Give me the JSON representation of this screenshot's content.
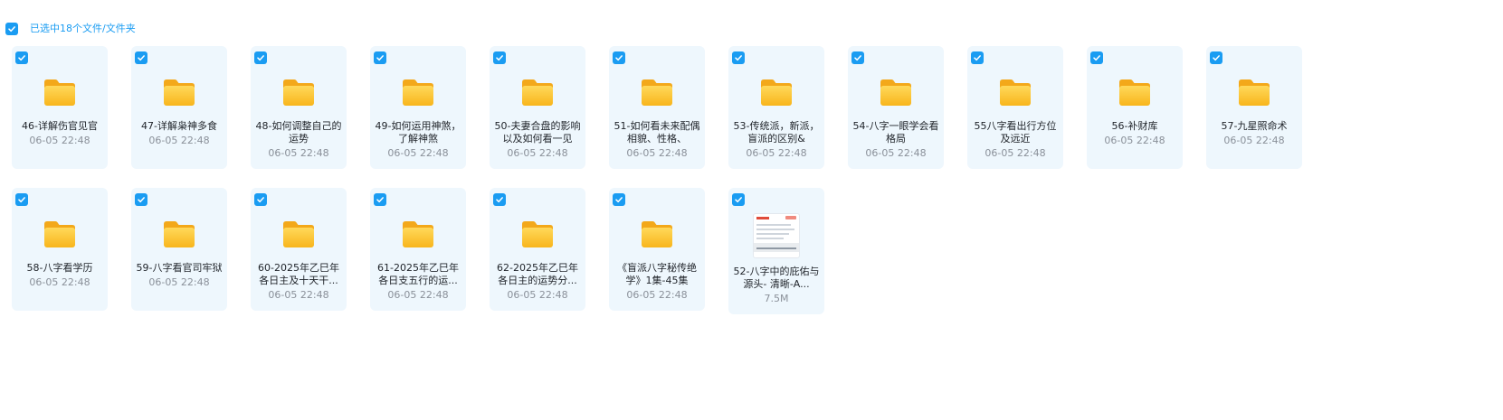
{
  "selection": {
    "label": "已选中18个文件/文件夹"
  },
  "items": [
    {
      "name": "46-详解伤官见官",
      "meta": "06-05 22:48",
      "type": "folder"
    },
    {
      "name": "47-详解枭神多食",
      "meta": "06-05 22:48",
      "type": "folder"
    },
    {
      "name": "48-如何调整自己的运势",
      "meta": "06-05 22:48",
      "type": "folder"
    },
    {
      "name": "49-如何运用神煞，了解神煞",
      "meta": "06-05 22:48",
      "type": "folder"
    },
    {
      "name": "50-夫妻合盘的影响以及如何看一见",
      "meta": "06-05 22:48",
      "type": "folder"
    },
    {
      "name": "51-如何看未来配偶 相貌、性格、",
      "meta": "06-05 22:48",
      "type": "folder"
    },
    {
      "name": "53-传统派，新派，盲派的区别&",
      "meta": "06-05 22:48",
      "type": "folder"
    },
    {
      "name": "54-八字一眼学会看格局",
      "meta": "06-05 22:48",
      "type": "folder"
    },
    {
      "name": "55八字看出行方位及远近",
      "meta": "06-05 22:48",
      "type": "folder"
    },
    {
      "name": "56-补财库",
      "meta": "06-05 22:48",
      "type": "folder"
    },
    {
      "name": "57-九星照命术",
      "meta": "06-05 22:48",
      "type": "folder"
    },
    {
      "name": "58-八字看学历",
      "meta": "06-05 22:48",
      "type": "folder"
    },
    {
      "name": "59-八字看官司牢狱",
      "meta": "06-05 22:48",
      "type": "folder"
    },
    {
      "name": "60-2025年乙巳年各日主及十天干...",
      "meta": "06-05 22:48",
      "type": "folder"
    },
    {
      "name": "61-2025年乙巳年各日支五行的运...",
      "meta": "06-05 22:48",
      "type": "folder"
    },
    {
      "name": "62-2025年乙巳年各日主的运势分...",
      "meta": "06-05 22:48",
      "type": "folder"
    },
    {
      "name": "《盲派八字秘传绝学》1集-45集",
      "meta": "06-05 22:48",
      "type": "folder"
    },
    {
      "name": "52-八字中的庇佑与源头- 清晰-A...",
      "meta": "7.5M",
      "type": "file"
    }
  ],
  "colors": {
    "accent": "#1a9cf2",
    "card_bg": "#eef7fd",
    "folder_top": "#ffd24a",
    "folder_bottom": "#f8b51c"
  },
  "icons": {
    "checkbox": "checkmark-icon",
    "folder": "folder-icon",
    "file": "document-thumbnail-icon"
  }
}
